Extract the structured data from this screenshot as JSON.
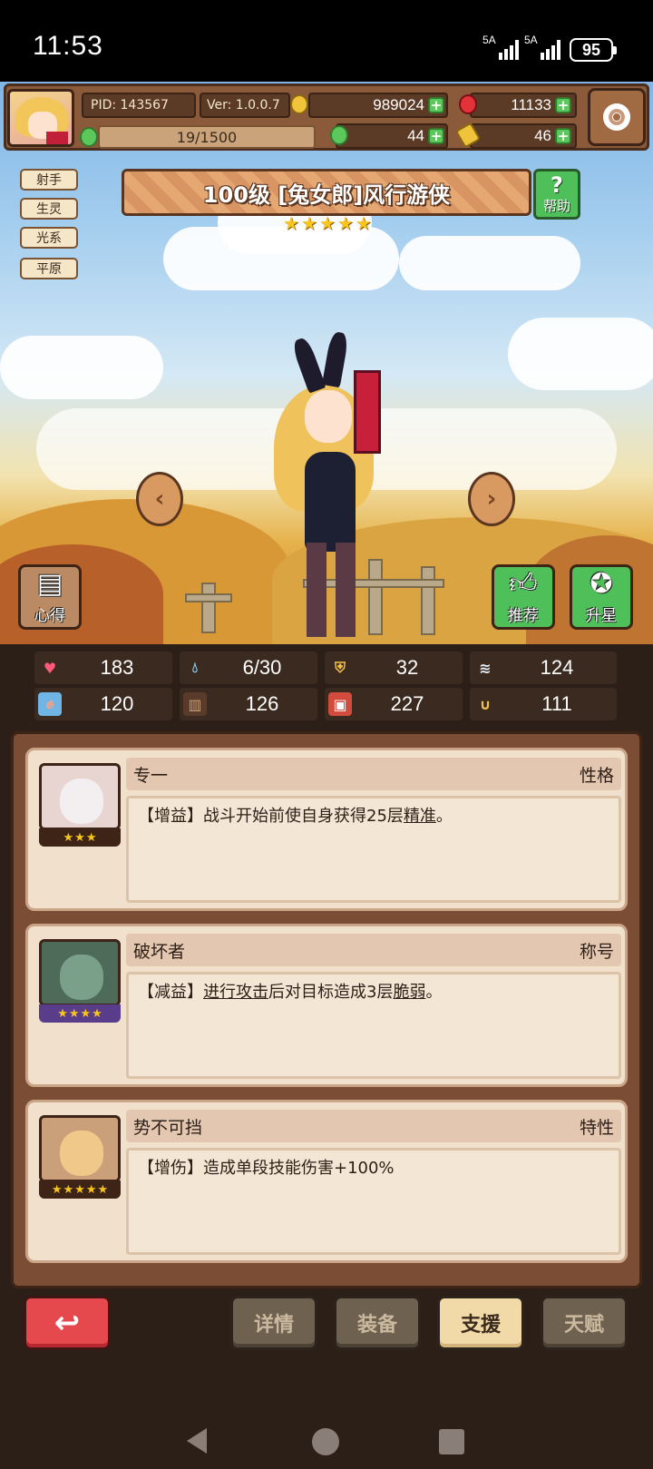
{
  "status_bar": {
    "time": "11:53",
    "signal_1": "5A",
    "signal_2": "5A",
    "battery": "95"
  },
  "header": {
    "pid": "PID: 143567",
    "version": "Ver: 1.0.0.7",
    "exp": "19/1500",
    "gold": "989024",
    "gems": "11133",
    "clover": "44",
    "key": "46"
  },
  "tags": [
    "射手",
    "生灵",
    "光系",
    "平原"
  ],
  "hero": {
    "title": "100级 [兔女郎]风行游侠",
    "stars": 5
  },
  "buttons": {
    "help": "帮助",
    "insight": "心得",
    "recommend": "推荐",
    "star_up": "升星"
  },
  "stats": [
    {
      "icon": "heart-icon",
      "value": "183",
      "color": "#ff5a7a"
    },
    {
      "icon": "water-drop-icon",
      "value": "6/30",
      "color": "#8fd6ff"
    },
    {
      "icon": "shield-icon",
      "value": "32",
      "color": "#f3c24a"
    },
    {
      "icon": "wing-icon",
      "value": "124",
      "color": "#e8eef6"
    },
    {
      "icon": "fist-icon",
      "value": "120",
      "color": "#f3a38a"
    },
    {
      "icon": "book-icon",
      "value": "126",
      "color": "#c9a07a"
    },
    {
      "icon": "scroll-icon",
      "value": "227",
      "color": "#5b8fe0"
    },
    {
      "icon": "magnet-icon",
      "value": "111",
      "color": "#f3c24a"
    }
  ],
  "cards": [
    {
      "name": "专一",
      "category": "性格",
      "stars": 3,
      "desc_prefix": "【增益】战斗开始前使自身获得25层",
      "desc_link": "精准",
      "desc_suffix": "。"
    },
    {
      "name": "破坏者",
      "category": "称号",
      "stars": 4,
      "desc_prefix": "【减益】",
      "desc_link": "进行攻击",
      "desc_mid": "后对目标造成3层",
      "desc_link2": "脆弱",
      "desc_suffix": "。"
    },
    {
      "name": "势不可挡",
      "category": "特性",
      "stars": 5,
      "desc_prefix": "【增伤】造成单段技能伤害+100%"
    }
  ],
  "bottom_tabs": {
    "details": "详情",
    "equipment": "装备",
    "support": "支援",
    "talent": "天赋"
  }
}
